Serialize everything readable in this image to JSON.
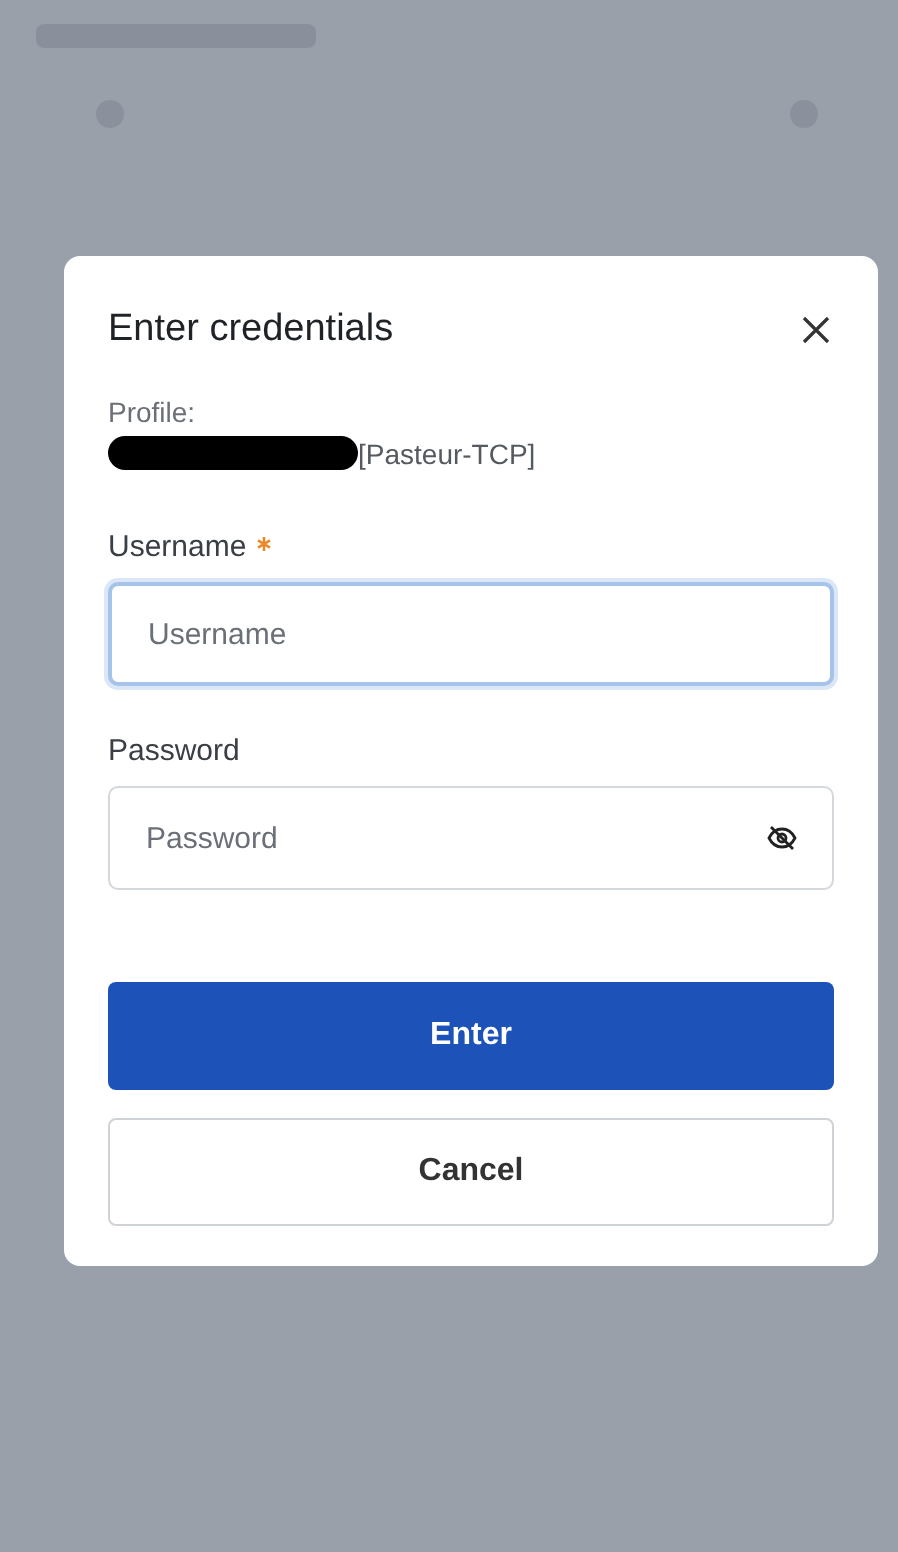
{
  "dialog": {
    "title": "Enter credentials",
    "profile": {
      "label": "Profile:",
      "value": "[Pasteur-TCP]",
      "redacted": true
    },
    "fields": [
      {
        "label": "Username",
        "required": true,
        "placeholder": "Username",
        "focused": true,
        "kind": "text"
      },
      {
        "label": "Password",
        "required": false,
        "placeholder": "Password",
        "focused": false,
        "kind": "password"
      }
    ],
    "buttons": [
      {
        "label": "Enter",
        "kind": "primary"
      },
      {
        "label": "Cancel",
        "kind": "secondary"
      }
    ]
  }
}
